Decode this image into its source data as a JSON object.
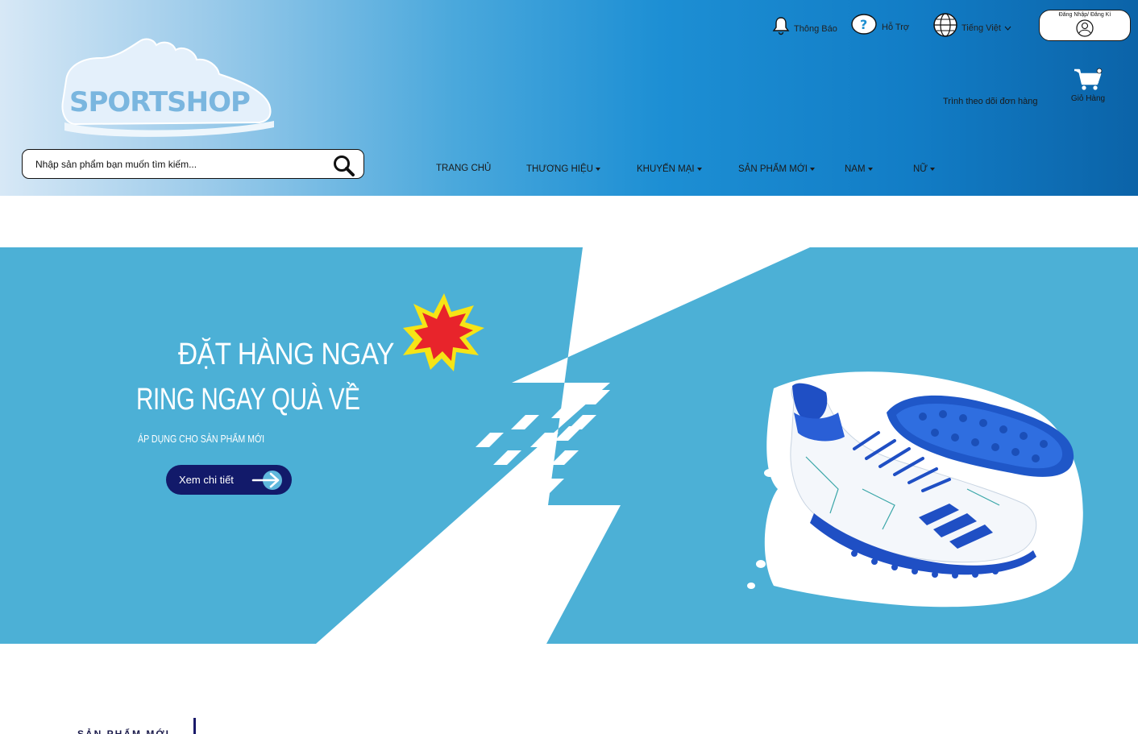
{
  "brand": {
    "logo_text": "SPORTSHOP",
    "colors": {
      "header_start": "#d7e8f6",
      "header_end": "#0b63a8",
      "banner": "#4cb0d6",
      "cta": "#121a6a",
      "burst_red": "#e8242b",
      "burst_yellow": "#f6e416"
    }
  },
  "search": {
    "placeholder": "Nhập sản phẩm bạn muốn tìm kiếm...",
    "icon": "search-icon"
  },
  "utilities": {
    "notifications": {
      "label": "Thông Báo",
      "icon": "bell-icon"
    },
    "support": {
      "label": "Hỗ Trợ",
      "icon": "question-icon"
    },
    "language": {
      "label": "Tiếng Việt",
      "icon": "globe-icon"
    },
    "login": {
      "label": "Đăng Nhập/ Đăng Kí",
      "icon": "user-icon"
    },
    "order_tracking": {
      "label": "Trình theo dõi đơn hàng"
    },
    "cart": {
      "label": "Giỏ Hàng",
      "icon": "cart-icon"
    }
  },
  "nav": {
    "items": [
      {
        "label": "TRANG CHỦ",
        "has_dropdown": false
      },
      {
        "label": "THƯƠNG HIỆU",
        "has_dropdown": true
      },
      {
        "label": "KHUYẾN MẠI",
        "has_dropdown": true
      },
      {
        "label": "SẢN PHẨM MỚI",
        "has_dropdown": true
      },
      {
        "label": "NAM",
        "has_dropdown": true
      },
      {
        "label": "NỮ",
        "has_dropdown": true
      }
    ]
  },
  "banner": {
    "headline_1": "ĐẶT HÀNG NGAY",
    "headline_2": "RING NGAY QUÀ VỀ",
    "subtext": "ÁP DỤNG CHO SẢN PHẨM MỚI",
    "cta_label": "Xem chi tiết",
    "product_image": "football-boots"
  },
  "section": {
    "title": "SẢN PHẨM MỚI"
  }
}
